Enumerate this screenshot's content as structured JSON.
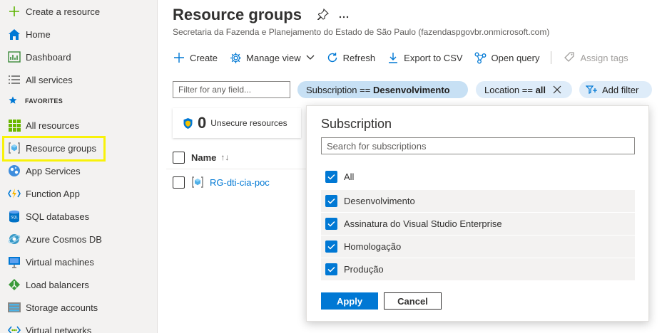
{
  "sidebar": {
    "items": [
      {
        "label": "Create a resource",
        "icon": "plus-icon"
      },
      {
        "label": "Home",
        "icon": "home-icon"
      },
      {
        "label": "Dashboard",
        "icon": "dashboard-icon"
      },
      {
        "label": "All services",
        "icon": "list-icon"
      },
      {
        "label": "All resources",
        "icon": "grid-icon"
      },
      {
        "label": "Resource groups",
        "icon": "resource-group-icon"
      },
      {
        "label": "App Services",
        "icon": "app-services-icon"
      },
      {
        "label": "Function App",
        "icon": "function-app-icon"
      },
      {
        "label": "SQL databases",
        "icon": "sql-database-icon"
      },
      {
        "label": "Azure Cosmos DB",
        "icon": "cosmos-db-icon"
      },
      {
        "label": "Virtual machines",
        "icon": "virtual-machine-icon"
      },
      {
        "label": "Load balancers",
        "icon": "load-balancer-icon"
      },
      {
        "label": "Storage accounts",
        "icon": "storage-account-icon"
      },
      {
        "label": "Virtual networks",
        "icon": "virtual-network-icon"
      }
    ],
    "favorites_label": "FAVORITES"
  },
  "header": {
    "title": "Resource groups",
    "subtitle": "Secretaria da Fazenda e Planejamento do Estado de São Paulo (fazendaspgovbr.onmicrosoft.com)"
  },
  "toolbar": {
    "create": "Create",
    "manage_view": "Manage view",
    "refresh": "Refresh",
    "export_csv": "Export to CSV",
    "open_query": "Open query",
    "assign_tags": "Assign tags"
  },
  "filters": {
    "search_placeholder": "Filter for any field...",
    "subscription_prefix": "Subscription == ",
    "subscription_value": "Desenvolvimento",
    "location_prefix": "Location == ",
    "location_value": "all",
    "add_filter": "Add filter"
  },
  "unsecure": {
    "count": "0",
    "label": "Unsecure resources"
  },
  "table": {
    "column_name": "Name",
    "rows": [
      {
        "name": "RG-dti-cia-poc"
      }
    ]
  },
  "popup": {
    "title": "Subscription",
    "search_placeholder": "Search for subscriptions",
    "all_label": "All",
    "options": [
      {
        "label": "Desenvolvimento",
        "checked": true
      },
      {
        "label": "Assinatura do Visual Studio Enterprise",
        "checked": true
      },
      {
        "label": "Homologação",
        "checked": true
      },
      {
        "label": "Produção",
        "checked": true
      }
    ],
    "apply": "Apply",
    "cancel": "Cancel"
  },
  "colors": {
    "accent": "#0078d4",
    "highlight": "#f8f20a",
    "sidebar_bg": "#f3f2f1"
  }
}
